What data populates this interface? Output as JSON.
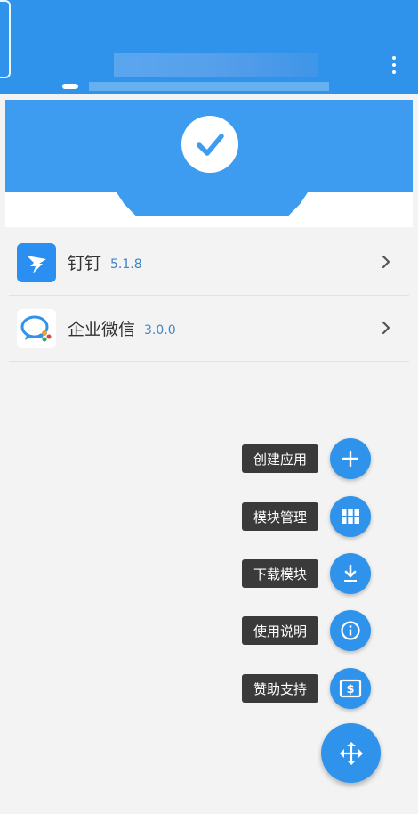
{
  "apps": [
    {
      "name": "钉钉",
      "version": "5.1.8",
      "icon": "dingtalk-icon"
    },
    {
      "name": "企业微信",
      "version": "3.0.0",
      "icon": "wework-icon"
    }
  ],
  "fab_menu": [
    {
      "label": "创建应用",
      "icon": "plus-icon"
    },
    {
      "label": "模块管理",
      "icon": "grid-icon"
    },
    {
      "label": "下载模块",
      "icon": "download-icon"
    },
    {
      "label": "使用说明",
      "icon": "info-icon"
    },
    {
      "label": "赞助支持",
      "icon": "donate-icon"
    }
  ],
  "fab_main_icon": "move-arrows-icon",
  "colors": {
    "primary": "#2f93ec",
    "label_bg": "#3a3a3a",
    "version": "#3f86c4"
  }
}
